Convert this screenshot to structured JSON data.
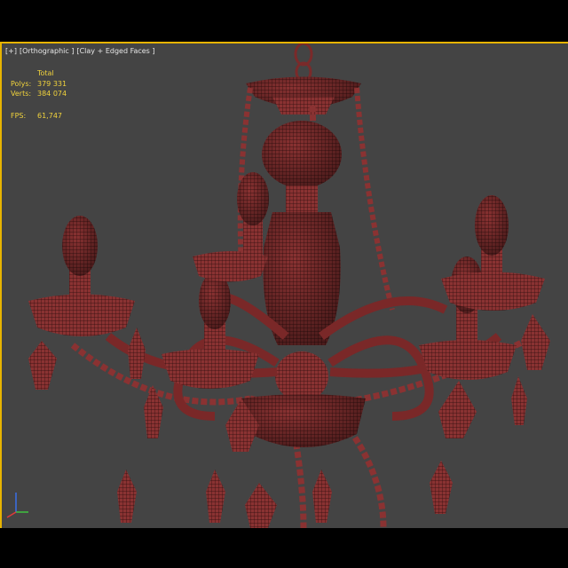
{
  "viewport": {
    "label_plus": "[+]",
    "label_view": "[Orthographic ]",
    "label_shading": "[Clay + Edged Faces ]"
  },
  "stats": {
    "header": "Total",
    "polys_label": "Polys:",
    "polys_value": "379 331",
    "verts_label": "Verts:",
    "verts_value": "384 074",
    "fps_label": "FPS:",
    "fps_value": "61,747"
  },
  "colors": {
    "viewport_bg": "#444444",
    "active_border": "#e8b400",
    "stat_text": "#f0d23c",
    "mesh_fill": "#8a3232",
    "mesh_wire": "#2a0c0c"
  }
}
